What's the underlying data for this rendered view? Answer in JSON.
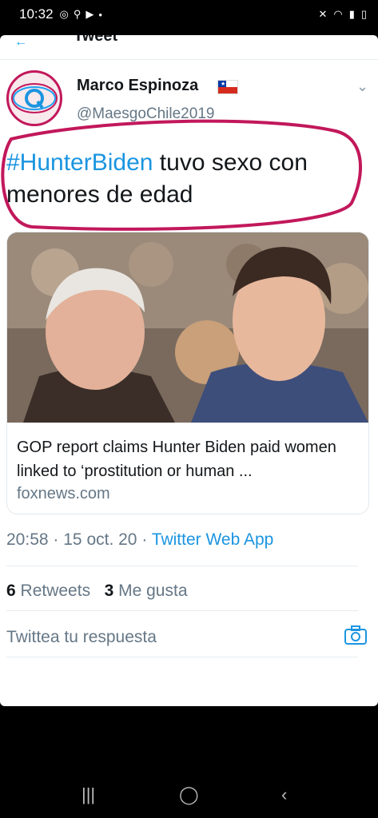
{
  "status_bar": {
    "time": "10:32",
    "left_icons": [
      "instagram-icon",
      "bike-icon",
      "youtube-icon",
      "dot-icon"
    ],
    "right_icons": [
      "mute-icon",
      "wifi-icon",
      "signal-icon",
      "battery-icon"
    ]
  },
  "header": {
    "title": "Tweet"
  },
  "tweet": {
    "author_name": "Marco Espinoza",
    "flag": "Chile",
    "handle": "@MaesgoChile2019",
    "hashtag": "#HunterBiden",
    "text": " tuvo sexo con menores de edad",
    "link_card": {
      "title": "GOP report claims Hunter Biden paid women linked to ‘prostitution or human ...",
      "domain": "foxnews.com"
    },
    "time": "20:58",
    "date": "15 oct. 20",
    "separator": "·",
    "source": "Twitter Web App",
    "retweet_count": "6",
    "retweet_label": "Retweets",
    "like_count": "3",
    "like_label": "Me gusta"
  },
  "reply": {
    "placeholder": "Twittea tu respuesta"
  },
  "colors": {
    "accent": "#1b95e0",
    "annotation": "#c2185b"
  }
}
